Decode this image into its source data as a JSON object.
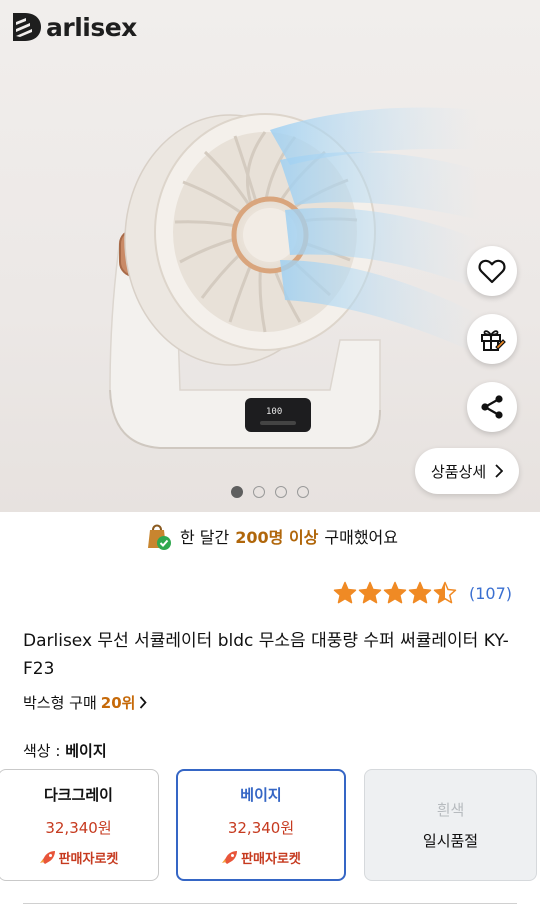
{
  "hero": {
    "brand": "arlisex",
    "detail_button_label": "상품상세",
    "image_index": 1,
    "image_count": 4
  },
  "icons": {
    "wishlist": "heart-icon",
    "gift": "gift-icon",
    "share": "share-icon",
    "chevron": "chevron-right-icon",
    "shopping_bag": "shopping-bag-icon",
    "rocket": "rocket-icon"
  },
  "banner": {
    "prefix": "한 달간",
    "highlight": "200명 이상",
    "suffix": "구매했어요"
  },
  "rating": {
    "stars": 4.5,
    "count": "(107)"
  },
  "product": {
    "title": "Darlisex 무선 서큘레이터 bldc 무소음 대풍량 수퍼 써큘레이터 KY-F23"
  },
  "rank": {
    "category": "박스형 구매",
    "position": "20위"
  },
  "color": {
    "label": "색상 :",
    "selected": "베이지"
  },
  "options": [
    {
      "name": "다크그레이",
      "price": "32,340원",
      "badge": "판매자로켓",
      "state": "available"
    },
    {
      "name": "베이지",
      "price": "32,340원",
      "badge": "판매자로켓",
      "state": "selected"
    },
    {
      "name": "흰색",
      "stock_status": "일시품절",
      "state": "soldout"
    }
  ],
  "colors": {
    "accent_blue": "#3566c5",
    "price_red": "#c63a1f",
    "highlight_orange": "#b0660a",
    "star_orange": "#f08a24"
  }
}
